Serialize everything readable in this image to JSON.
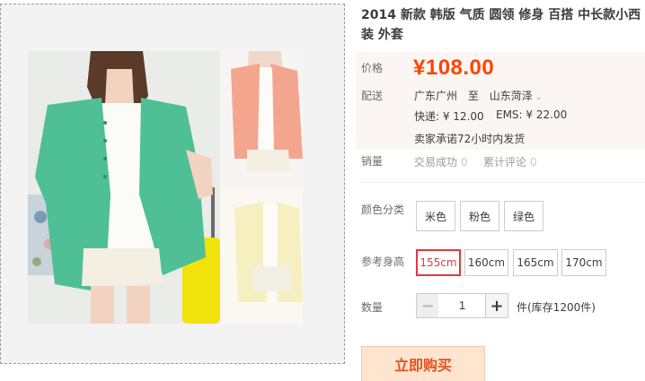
{
  "product": {
    "title": "2014 新款 韩版 气质 圆领 修身 百搭 中长款小西装 外套"
  },
  "price": {
    "label": "价格",
    "value": "¥108.00"
  },
  "shipping": {
    "label": "配送",
    "from": "广东广州",
    "to_word": "至",
    "destination": "山东菏泽",
    "express": "快递: ¥ 12.00",
    "ems": "EMS: ¥ 22.00",
    "promise": "卖家承诺72小时内发货"
  },
  "sales": {
    "label": "销量",
    "deals_label": "交易成功",
    "deals_count": "0",
    "reviews_label": "累计评论",
    "reviews_count": "0"
  },
  "color": {
    "label": "颜色分类",
    "options": [
      "米色",
      "粉色",
      "绿色"
    ]
  },
  "height": {
    "label": "参考身高",
    "options": [
      "155cm",
      "160cm",
      "165cm",
      "170cm"
    ],
    "selected": "155cm"
  },
  "quantity": {
    "label": "数量",
    "value": "1",
    "minus": "−",
    "plus": "+",
    "stock": "件(库存1200件)"
  },
  "buy_button": {
    "label": "立即购买"
  },
  "colors": {
    "price": "#ff4400",
    "selected_border": "#e4393c",
    "buy_bg": "#ffe4d0",
    "buy_text": "#e5511d",
    "jacket_green": "#4fbf95",
    "jacket_pink": "#f4a58e",
    "jacket_cream": "#f6efc0",
    "suitcase_yellow": "#f2e20c"
  }
}
